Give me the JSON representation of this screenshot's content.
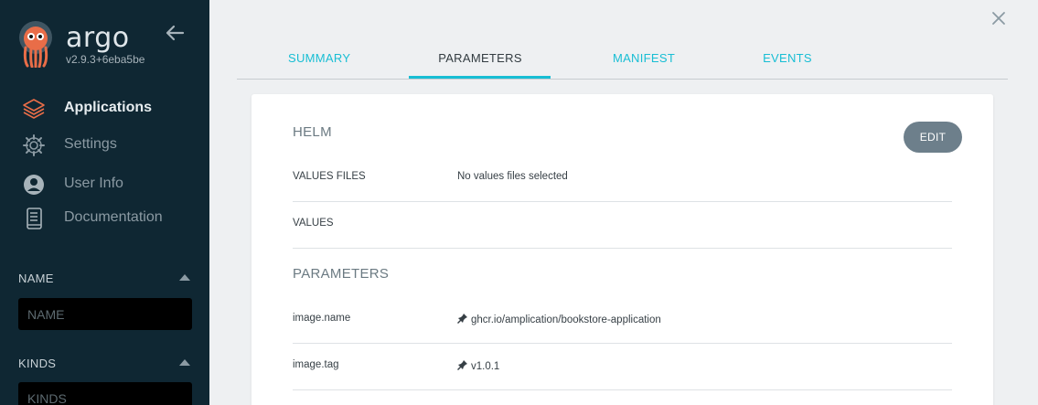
{
  "brand": {
    "name": "argo",
    "version": "v2.9.3+6eba5be"
  },
  "nav": {
    "items": [
      {
        "label": "Applications",
        "icon": "stack-icon"
      },
      {
        "label": "Settings",
        "icon": "gear-icon"
      },
      {
        "label": "User Info",
        "icon": "user-icon"
      },
      {
        "label": "Documentation",
        "icon": "book-icon"
      }
    ]
  },
  "filters": {
    "name": {
      "title": "NAME",
      "placeholder": "NAME"
    },
    "kinds": {
      "title": "KINDS",
      "placeholder": "KINDS"
    }
  },
  "tabs": [
    {
      "label": "SUMMARY"
    },
    {
      "label": "PARAMETERS"
    },
    {
      "label": "MANIFEST"
    },
    {
      "label": "EVENTS"
    }
  ],
  "panel": {
    "helm_title": "HELM",
    "edit_label": "EDIT",
    "values_files": {
      "key": "VALUES FILES",
      "value": "No values files selected"
    },
    "values": {
      "key": "VALUES",
      "value": ""
    },
    "parameters_title": "PARAMETERS",
    "parameters": [
      {
        "key": "image.name",
        "value": "ghcr.io/amplication/bookstore-application"
      },
      {
        "key": "image.tag",
        "value": "v1.0.1"
      }
    ]
  },
  "colors": {
    "accent": "#18bed4",
    "sidebar": "#0f2733",
    "edit": "#6d7f8b",
    "logo_orange": "#e96d48"
  }
}
